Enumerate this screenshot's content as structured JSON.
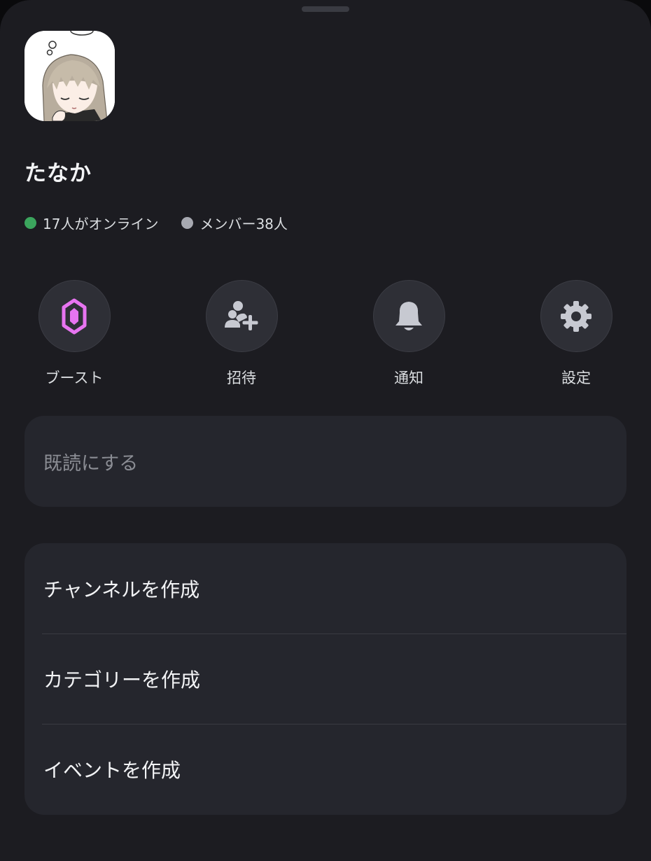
{
  "server": {
    "name": "たなか"
  },
  "stats": {
    "online_text": "17人がオンライン",
    "members_text": "メンバー38人",
    "online_color": "#3ba55d",
    "members_color": "#a7a9b1"
  },
  "actions": [
    {
      "label": "ブースト",
      "icon": "boost-gem-icon",
      "color": "#e774f0"
    },
    {
      "label": "招待",
      "icon": "invite-user-plus-icon",
      "color": "#c7c9d1"
    },
    {
      "label": "通知",
      "icon": "bell-icon",
      "color": "#c7c9d1"
    },
    {
      "label": "設定",
      "icon": "gear-icon",
      "color": "#c7c9d1"
    }
  ],
  "mark_read": {
    "label": "既読にする"
  },
  "create_menu": [
    {
      "label": "チャンネルを作成"
    },
    {
      "label": "カテゴリーを作成"
    },
    {
      "label": "イベントを作成"
    }
  ],
  "colors": {
    "sheet_background": "#1c1c21",
    "card_background": "#25262d",
    "action_circle": "#2e2f36"
  }
}
